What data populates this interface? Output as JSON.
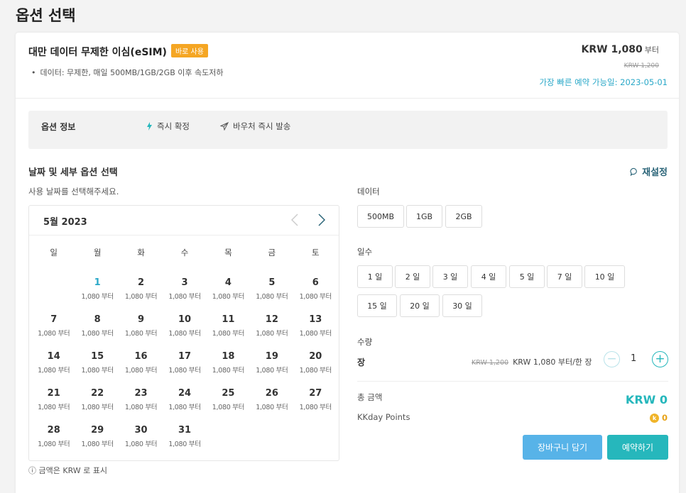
{
  "page_title": "옵션 선택",
  "product": {
    "title": "대만 데이터 무제한 이심(eSIM)",
    "badge": "바로 사용",
    "desc": "데이터: 무제한, 매일 500MB/1GB/2GB 이후 속도저하",
    "price": "KRW 1,080",
    "price_suffix": "부터",
    "original_price": "KRW 1,200",
    "earliest": "가장 빠른 예약 가능일: 2023-05-01"
  },
  "info_bar": {
    "label": "옵션 정보",
    "instant_confirm": "즉시 확정",
    "voucher": "바우처 즉시 발송"
  },
  "section": {
    "title": "날짜 및 세부 옵션 선택",
    "reset": "재설정",
    "date_hint": "사용 날짜를 선택해주세요."
  },
  "calendar": {
    "month": "5월 2023",
    "weekdays": [
      "일",
      "월",
      "화",
      "수",
      "목",
      "금",
      "토"
    ],
    "days": [
      {
        "num": "",
        "price": ""
      },
      {
        "num": "1",
        "price": "1,080 부터"
      },
      {
        "num": "2",
        "price": "1,080 부터"
      },
      {
        "num": "3",
        "price": "1,080 부터"
      },
      {
        "num": "4",
        "price": "1,080 부터"
      },
      {
        "num": "5",
        "price": "1,080 부터"
      },
      {
        "num": "6",
        "price": "1,080 부터"
      },
      {
        "num": "7",
        "price": "1,080 부터"
      },
      {
        "num": "8",
        "price": "1,080 부터"
      },
      {
        "num": "9",
        "price": "1,080 부터"
      },
      {
        "num": "10",
        "price": "1,080 부터"
      },
      {
        "num": "11",
        "price": "1,080 부터"
      },
      {
        "num": "12",
        "price": "1,080 부터"
      },
      {
        "num": "13",
        "price": "1,080 부터"
      },
      {
        "num": "14",
        "price": "1,080 부터"
      },
      {
        "num": "15",
        "price": "1,080 부터"
      },
      {
        "num": "16",
        "price": "1,080 부터"
      },
      {
        "num": "17",
        "price": "1,080 부터"
      },
      {
        "num": "18",
        "price": "1,080 부터"
      },
      {
        "num": "19",
        "price": "1,080 부터"
      },
      {
        "num": "20",
        "price": "1,080 부터"
      },
      {
        "num": "21",
        "price": "1,080 부터"
      },
      {
        "num": "22",
        "price": "1,080 부터"
      },
      {
        "num": "23",
        "price": "1,080 부터"
      },
      {
        "num": "24",
        "price": "1,080 부터"
      },
      {
        "num": "25",
        "price": "1,080 부터"
      },
      {
        "num": "26",
        "price": "1,080 부터"
      },
      {
        "num": "27",
        "price": "1,080 부터"
      },
      {
        "num": "28",
        "price": "1,080 부터"
      },
      {
        "num": "29",
        "price": "1,080 부터"
      },
      {
        "num": "30",
        "price": "1,080 부터"
      },
      {
        "num": "31",
        "price": "1,080 부터"
      }
    ],
    "note": "ⓘ 금액은 KRW 로 표시"
  },
  "options": {
    "data_label": "데이터",
    "data": [
      "500MB",
      "1GB",
      "2GB"
    ],
    "days_label": "일수",
    "days_row1": [
      "1 일",
      "2 일",
      "3 일",
      "4 일",
      "5 일",
      "7 일",
      "10 일"
    ],
    "days_row2": [
      "15 일",
      "20 일",
      "30 일"
    ]
  },
  "quantity": {
    "label": "수량",
    "unit": "장",
    "original_price": "KRW 1,200",
    "price": "KRW 1,080 부터/한 장",
    "value": "1",
    "minus": "−",
    "plus": "+"
  },
  "totals": {
    "total_label": "총 금액",
    "total_value": "KRW 0",
    "points_label": "KKday Points",
    "points_value": "0",
    "coin_letter": "k"
  },
  "buttons": {
    "cart": "장바구니 담기",
    "book": "예약하기"
  }
}
